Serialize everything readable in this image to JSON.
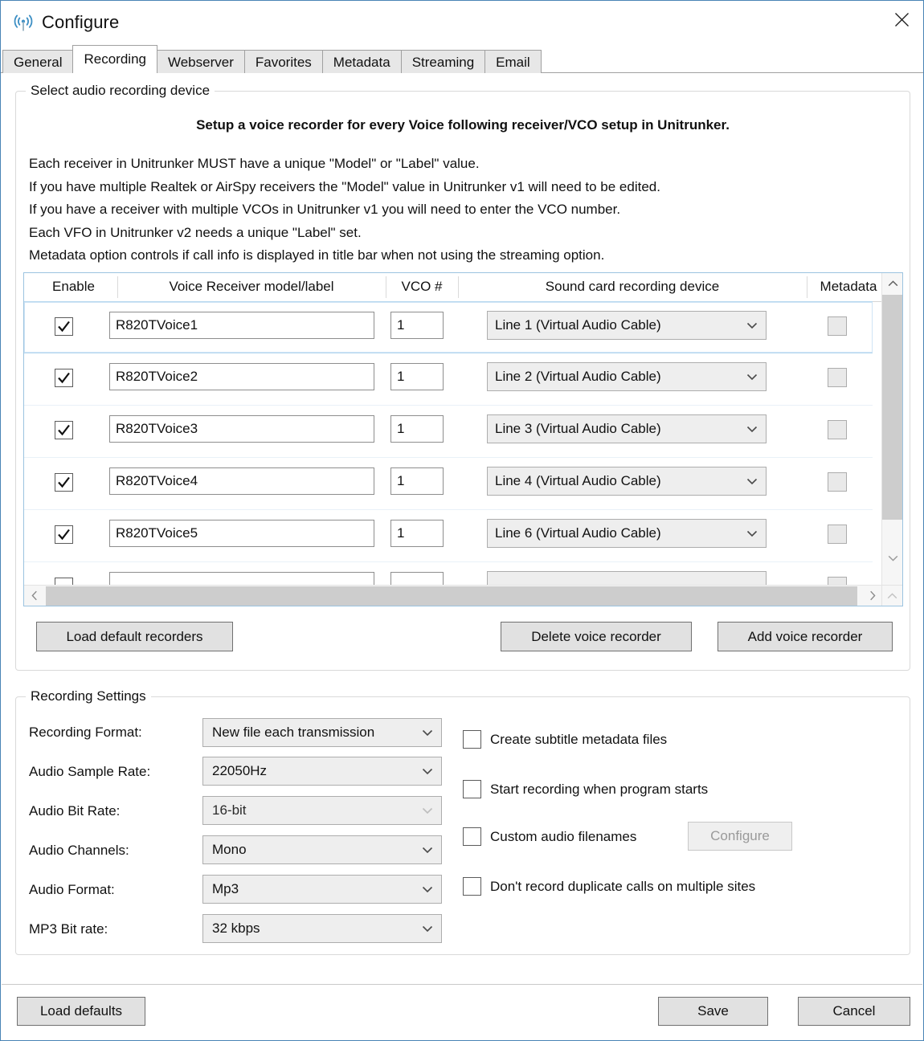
{
  "window": {
    "title": "Configure",
    "icon": "broadcast-antenna-icon",
    "close_label": "✕",
    "accent_color": "#4a84b5"
  },
  "tabs": [
    {
      "label": "General",
      "active": false
    },
    {
      "label": "Recording",
      "active": true
    },
    {
      "label": "Webserver",
      "active": false
    },
    {
      "label": "Favorites",
      "active": false
    },
    {
      "label": "Metadata",
      "active": false
    },
    {
      "label": "Streaming",
      "active": false
    },
    {
      "label": "Email",
      "active": false
    }
  ],
  "device_group": {
    "legend": "Select audio recording device",
    "headline": "Setup a voice recorder for every Voice following receiver/VCO setup in Unitrunker.",
    "notes": [
      "Each receiver in Unitrunker MUST have a unique \"Model\" or \"Label\" value.",
      "If you have multiple Realtek or AirSpy receivers the \"Model\" value in Unitrunker v1 will need to be edited.",
      "If you have a receiver with multiple VCOs in Unitrunker v1 you will need to enter the VCO number.",
      "Each VFO in Unitrunker v2 needs a unique \"Label\" set.",
      "Metadata option controls if call info is displayed in title bar when not using the streaming option."
    ],
    "columns": [
      "Enable",
      "Voice Receiver model/label",
      "VCO #",
      "Sound card recording device",
      "Metadata"
    ],
    "rows": [
      {
        "enabled": true,
        "label": "R820TVoice1",
        "vco": "1",
        "device": "Line 1 (Virtual Audio Cable)",
        "metadata": false,
        "selected": true
      },
      {
        "enabled": true,
        "label": "R820TVoice2",
        "vco": "1",
        "device": "Line 2 (Virtual Audio Cable)",
        "metadata": false,
        "selected": false
      },
      {
        "enabled": true,
        "label": "R820TVoice3",
        "vco": "1",
        "device": "Line 3 (Virtual Audio Cable)",
        "metadata": false,
        "selected": false
      },
      {
        "enabled": true,
        "label": "R820TVoice4",
        "vco": "1",
        "device": "Line 4 (Virtual Audio Cable)",
        "metadata": false,
        "selected": false
      },
      {
        "enabled": true,
        "label": "R820TVoice5",
        "vco": "1",
        "device": "Line 6 (Virtual Audio Cable)",
        "metadata": false,
        "selected": false
      },
      {
        "enabled": true,
        "label": "",
        "vco": "",
        "device": "",
        "metadata": false,
        "selected": false
      }
    ],
    "buttons": {
      "load_recorders": "Load default recorders",
      "delete_recorder": "Delete voice recorder",
      "add_recorder": "Add voice recorder"
    }
  },
  "settings_group": {
    "legend": "Recording Settings",
    "fields": [
      {
        "label": "Recording Format:",
        "value": "New file each transmission",
        "disabled": false
      },
      {
        "label": "Audio Sample Rate:",
        "value": "22050Hz",
        "disabled": false
      },
      {
        "label": "Audio Bit Rate:",
        "value": "16-bit",
        "disabled": true
      },
      {
        "label": "Audio Channels:",
        "value": "Mono",
        "disabled": false
      },
      {
        "label": "Audio Format:",
        "value": "Mp3",
        "disabled": false
      },
      {
        "label": "MP3 Bit rate:",
        "value": "32 kbps",
        "disabled": false
      }
    ],
    "checkboxes": [
      {
        "label": "Create subtitle metadata files",
        "checked": false
      },
      {
        "label": "Start recording when program starts",
        "checked": false
      },
      {
        "label": "Custom audio filenames",
        "checked": false
      },
      {
        "label": "Don't record duplicate calls on multiple sites",
        "checked": false
      }
    ],
    "configure_button": {
      "label": "Configure",
      "disabled": true
    }
  },
  "footer": {
    "load_defaults": "Load defaults",
    "save": "Save",
    "cancel": "Cancel"
  }
}
